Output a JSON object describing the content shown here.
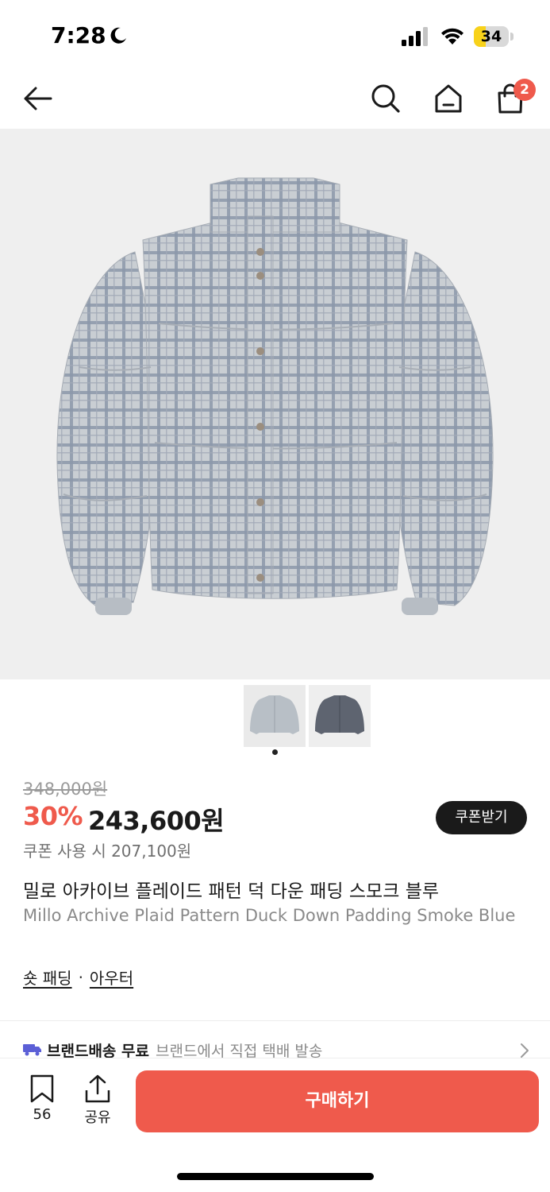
{
  "status_bar": {
    "time": "7:28",
    "battery": "34",
    "battery_level": 0.34,
    "accent": "#f8d21a"
  },
  "nav": {
    "back_icon": "arrow-left-icon",
    "search_icon": "search-icon",
    "home_icon": "home-icon",
    "bag_icon": "shopping-bag-icon",
    "bag_badge": "2"
  },
  "gallery": {
    "thumbnails": [
      {
        "name": "thumbnail-light-plaid",
        "color": "#b8bfc6"
      },
      {
        "name": "thumbnail-dark-plaid",
        "color": "#5e6470"
      }
    ],
    "current_index": 1,
    "total": 1
  },
  "product": {
    "original_price": "348,000원",
    "discount": "30%",
    "sale_price": "243,600원",
    "coupon_button": "쿠폰받기",
    "coupon_price": "쿠폰 사용 시 207,100원",
    "title_ko": "밀로 아카이브 플레이드 패턴 덕 다운 패딩 스모크 블루",
    "title_en": "Millo Archive Plaid Pattern Duck Down Padding Smoke Blue",
    "categories": [
      "숏 패딩",
      "아우터"
    ],
    "category_separator": "·"
  },
  "shipping": {
    "label": "브랜드배송 무료",
    "description": "브랜드에서 직접 택배 발송"
  },
  "bottom_bar": {
    "save_count": "56",
    "share_label": "공유",
    "buy_label": "구매하기"
  },
  "colors": {
    "brand": "#ef5a4c",
    "text": "#1a1a1a",
    "muted": "#8a8a8a"
  }
}
